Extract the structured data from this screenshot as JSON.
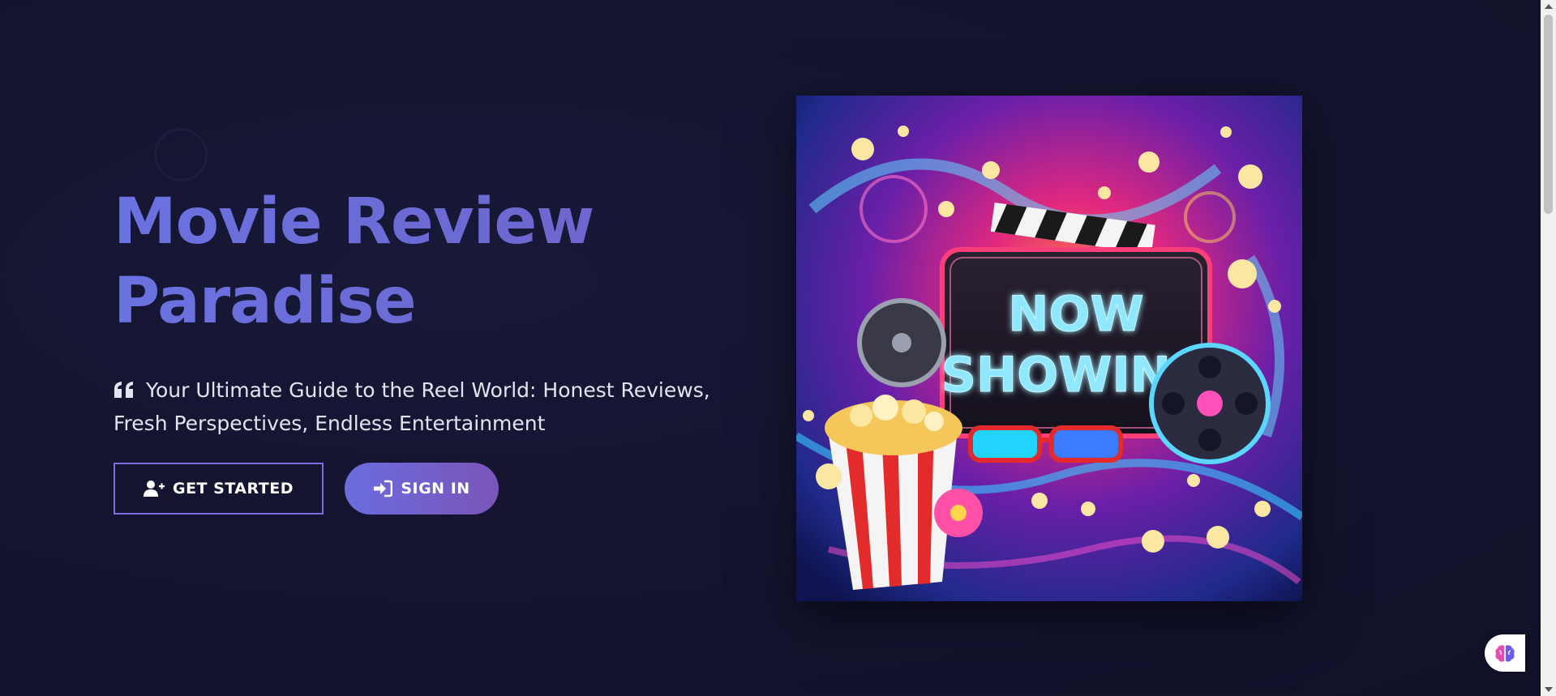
{
  "hero": {
    "title_line1": "Movie Review",
    "title_line2": "Paradise",
    "tagline": "Your Ultimate Guide to the Reel World: Honest Reviews, Fresh Perspectives, Endless Entertainment",
    "quote_icon": "quote-left-icon"
  },
  "buttons": {
    "get_started": {
      "label": "GET STARTED",
      "icon": "user-plus-icon"
    },
    "sign_in": {
      "label": "SIGN IN",
      "icon": "sign-in-icon"
    }
  },
  "image": {
    "sign_line1": "NOW",
    "sign_line2": "SHOWING"
  },
  "assistant": {
    "icon": "brain-icon"
  },
  "colors": {
    "background": "#13132e",
    "accent": "#6a72e0",
    "accent_secondary": "#7a55b8",
    "neon_text": "#8fe8ff"
  }
}
